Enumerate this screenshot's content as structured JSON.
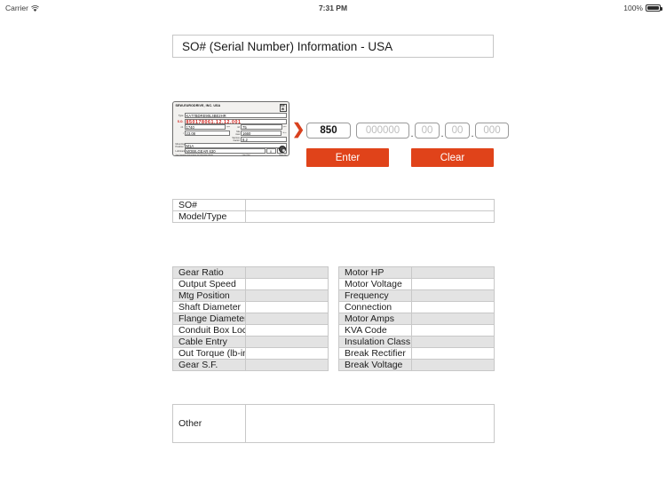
{
  "statusbar": {
    "carrier": "Carrier",
    "wifi_icon": "wifi-icon",
    "time": "7:31 PM",
    "battery_percent": "100%",
    "battery_icon": "battery-full-icon"
  },
  "header": {
    "title": "SO# (Serial Number) Information - USA"
  },
  "nameplate": {
    "brand": "SEW-EURODRIVE, INC. USA",
    "logo": "SE\nW",
    "type_label": "Type",
    "type_value": "KA77BDRE90L4BE2HR",
    "so_label": "S.O.",
    "so_value": "850178061.12.12.001",
    "input_speed_label": "n1",
    "input_speed_value": "1740",
    "input_speed_unit": "rpm",
    "output_speed_label": "n2",
    "output_speed_value": "75",
    "output_speed_unit": "rpm",
    "ratio_label": "i",
    "ratio_value": "23.08",
    "torque_label": "Ma max",
    "torque_value": "1660",
    "torque_unit": "lb-in",
    "sf_label": "Service Factor",
    "sf_value": "8.2",
    "mounting_label": "Mounting Position",
    "mounting_value": "M1A",
    "lubricant_label": "Lubricant",
    "lubricant_value": "MOBILGEAR 630",
    "qty1": "0",
    "qty1_unit": "l",
    "qty2": "40",
    "qty2_unit": "lb",
    "footnote_left": "See Operating Instructions for lubrication details",
    "footnote_mid": "Liter (Qts)",
    "footnote_right": "Mass (lb)"
  },
  "serial_input": {
    "arrow_icon": "red-chevron-right-icon",
    "field_so_value": "850",
    "field_so_placeholder": "850",
    "field_2_placeholder": "000000",
    "field_3_placeholder": "00",
    "field_4_placeholder": "00",
    "field_5_placeholder": "000",
    "separator": "."
  },
  "buttons": {
    "enter": "Enter",
    "clear": "Clear",
    "accent_color": "#e0431a"
  },
  "top_table": {
    "rows": [
      {
        "label": "SO#",
        "value": ""
      },
      {
        "label": "Model/Type",
        "value": ""
      }
    ]
  },
  "gear_table": {
    "rows": [
      {
        "label": "Gear Ratio",
        "value": ""
      },
      {
        "label": "Output Speed",
        "value": ""
      },
      {
        "label": "Mtg Position",
        "value": ""
      },
      {
        "label": "Shaft Diameter",
        "value": ""
      },
      {
        "label": "Flange Diameter",
        "value": ""
      },
      {
        "label": "Conduit Box Loc",
        "value": ""
      },
      {
        "label": "Cable Entry",
        "value": ""
      },
      {
        "label": "Out Torque (lb-in)",
        "value": ""
      },
      {
        "label": "Gear S.F.",
        "value": ""
      }
    ]
  },
  "motor_table": {
    "rows": [
      {
        "label": "Motor HP",
        "value": ""
      },
      {
        "label": "Motor Voltage",
        "value": ""
      },
      {
        "label": "Frequency",
        "value": ""
      },
      {
        "label": "Connection",
        "value": ""
      },
      {
        "label": "Motor Amps",
        "value": ""
      },
      {
        "label": "KVA Code",
        "value": ""
      },
      {
        "label": "Insulation Class",
        "value": ""
      },
      {
        "label": "Break Rectifier",
        "value": ""
      },
      {
        "label": "Break Voltage",
        "value": ""
      }
    ]
  },
  "other_section": {
    "label": "Other",
    "value": ""
  }
}
